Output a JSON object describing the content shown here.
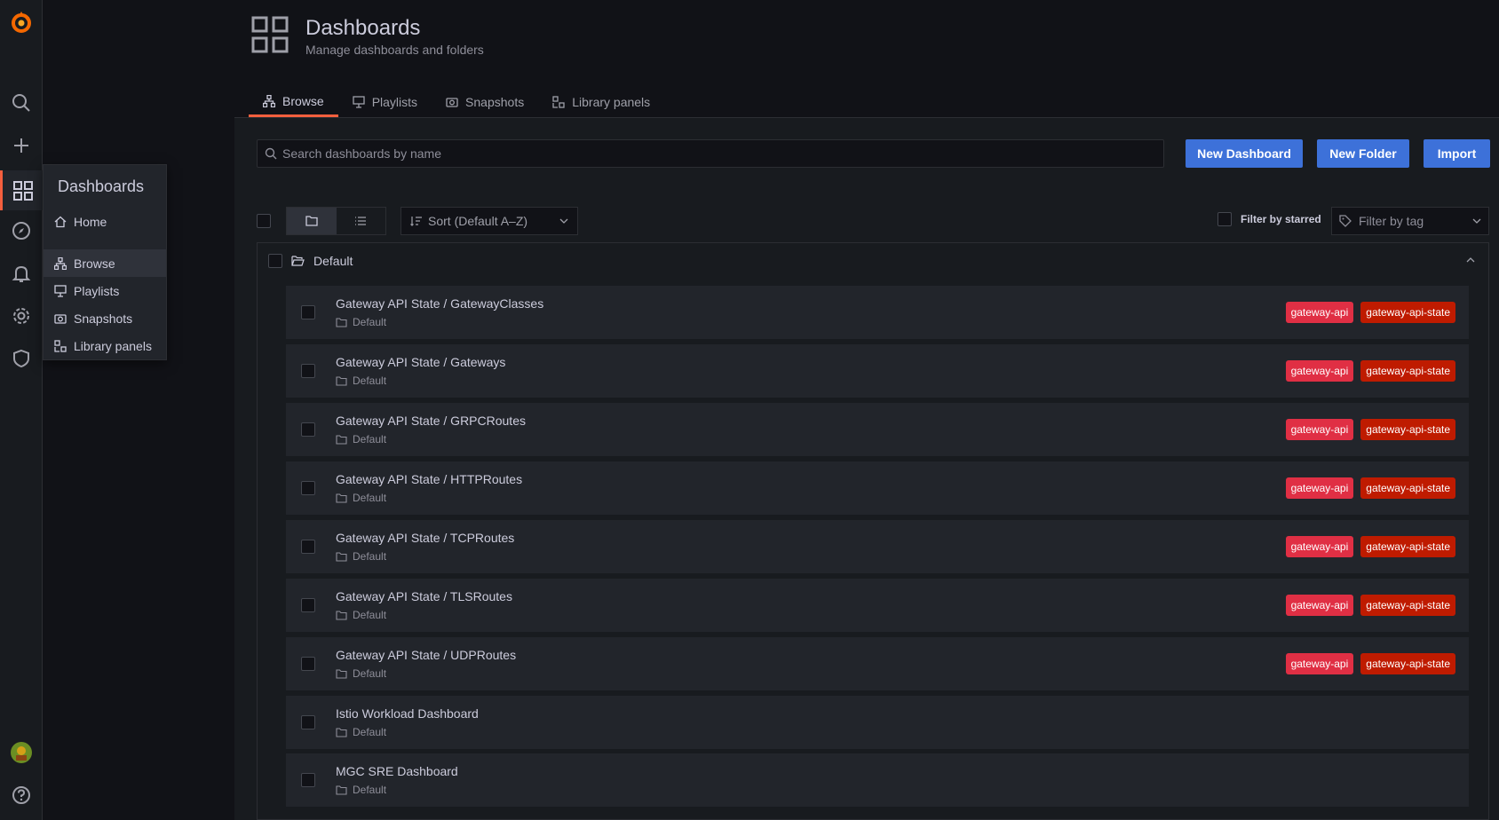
{
  "nav": {
    "icons": [
      "grafana-logo-icon",
      "search-icon",
      "plus-icon",
      "dashboards-icon",
      "explore-compass-icon",
      "alerting-bell-icon",
      "gear-icon",
      "shield-icon",
      "avatar",
      "help-icon"
    ]
  },
  "flyout": {
    "title": "Dashboards",
    "items": [
      {
        "label": "Home",
        "icon": "home-icon"
      },
      {
        "label": "Browse",
        "icon": "sitemap-icon",
        "selected": true
      },
      {
        "label": "Playlists",
        "icon": "presentation-icon"
      },
      {
        "label": "Snapshots",
        "icon": "camera-icon"
      },
      {
        "label": "Library panels",
        "icon": "library-panels-icon"
      }
    ]
  },
  "header": {
    "title": "Dashboards",
    "subtitle": "Manage dashboards and folders",
    "tabs": [
      {
        "label": "Browse",
        "active": true
      },
      {
        "label": "Playlists"
      },
      {
        "label": "Snapshots"
      },
      {
        "label": "Library panels"
      }
    ]
  },
  "search": {
    "placeholder": "Search dashboards by name",
    "value": ""
  },
  "actions": {
    "new_dashboard": "New Dashboard",
    "new_folder": "New Folder",
    "import": "Import"
  },
  "controls": {
    "sort_label": "Sort (Default A–Z)",
    "filter_starred": "Filter by starred",
    "tag_placeholder": "Filter by tag"
  },
  "folder": {
    "name": "Default",
    "rows": [
      {
        "title": "Gateway API State / GatewayClasses",
        "folder": "Default",
        "tags": [
          "gateway-api",
          "gateway-api-state"
        ]
      },
      {
        "title": "Gateway API State / Gateways",
        "folder": "Default",
        "tags": [
          "gateway-api",
          "gateway-api-state"
        ]
      },
      {
        "title": "Gateway API State / GRPCRoutes",
        "folder": "Default",
        "tags": [
          "gateway-api",
          "gateway-api-state"
        ]
      },
      {
        "title": "Gateway API State / HTTPRoutes",
        "folder": "Default",
        "tags": [
          "gateway-api",
          "gateway-api-state"
        ]
      },
      {
        "title": "Gateway API State / TCPRoutes",
        "folder": "Default",
        "tags": [
          "gateway-api",
          "gateway-api-state"
        ]
      },
      {
        "title": "Gateway API State / TLSRoutes",
        "folder": "Default",
        "tags": [
          "gateway-api",
          "gateway-api-state"
        ]
      },
      {
        "title": "Gateway API State / UDPRoutes",
        "folder": "Default",
        "tags": [
          "gateway-api",
          "gateway-api-state"
        ]
      },
      {
        "title": "Istio Workload Dashboard",
        "folder": "Default",
        "tags": []
      },
      {
        "title": "MGC SRE Dashboard",
        "folder": "Default",
        "tags": []
      }
    ]
  },
  "colors": {
    "accent": "#f55f3e",
    "primary_button": "#3d71d9",
    "tag_gateway_api": "#e02f44",
    "tag_gateway_api_state": "#bf1b00"
  }
}
